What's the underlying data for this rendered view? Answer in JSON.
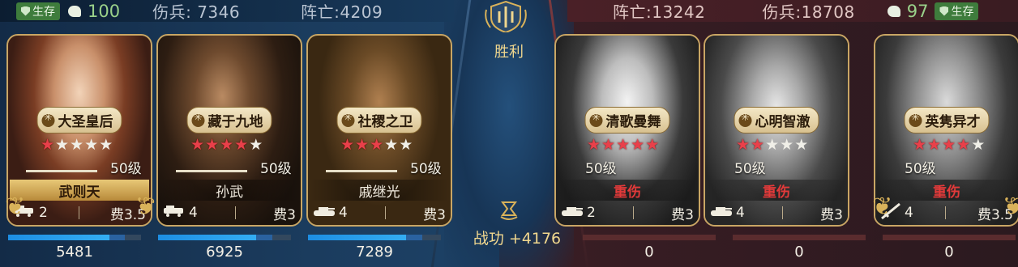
{
  "left_side": {
    "status": "生存",
    "troops": "100",
    "wounded_label": "伤兵: 7346",
    "dead_label": "阵亡:4209"
  },
  "right_side": {
    "status": "生存",
    "troops": "97",
    "wounded_label": "伤兵:18708",
    "dead_label": "阵亡:13242"
  },
  "center": {
    "result": "胜利",
    "merit": "战功 +4176"
  },
  "colors": {
    "ally_hp": "#2ea2ee",
    "enemy_hp": "#8a2a2e",
    "star_on": "#e9404a",
    "gold": "#d9b25a"
  },
  "ally_cards": [
    {
      "skill": "大圣皇后",
      "stars": 1,
      "level": "50级",
      "name": "武则天",
      "name_style": "gold",
      "unit_icon": "cart-icon",
      "unit_count": "2",
      "cost": "费3.5",
      "hp": "5481",
      "hp_ratio": 0.88,
      "laurel": true
    },
    {
      "skill": "藏于九地",
      "stars": 4,
      "level": "50级",
      "name": "孙武",
      "name_style": "plain",
      "unit_icon": "cart-icon",
      "unit_count": "4",
      "cost": "费3",
      "hp": "6925",
      "hp_ratio": 0.86,
      "laurel": false
    },
    {
      "skill": "社稷之卫",
      "stars": 3,
      "level": "50级",
      "name": "戚继光",
      "name_style": "plain",
      "unit_icon": "tank-icon",
      "unit_count": "4",
      "cost": "费3",
      "hp": "7289",
      "hp_ratio": 0.86,
      "laurel": false
    }
  ],
  "enemy_cards": [
    {
      "skill": "清歌曼舞",
      "stars": 5,
      "level": "50级",
      "name": "重伤",
      "name_style": "injured",
      "unit_icon": "tank-icon",
      "unit_count": "2",
      "cost": "费3",
      "hp": "0",
      "hp_ratio": 0,
      "laurel": false
    },
    {
      "skill": "心明智澈",
      "stars": 2,
      "level": "50级",
      "name": "重伤",
      "name_style": "injured",
      "unit_icon": "tank-icon",
      "unit_count": "4",
      "cost": "费3",
      "hp": "0",
      "hp_ratio": 0,
      "laurel": false
    },
    {
      "skill": "英隽异才",
      "stars": 4,
      "level": "50级",
      "name": "重伤",
      "name_style": "injured",
      "unit_icon": "rifle-icon",
      "unit_count": "4",
      "cost": "费3.5",
      "hp": "0",
      "hp_ratio": 0,
      "laurel": true
    }
  ]
}
